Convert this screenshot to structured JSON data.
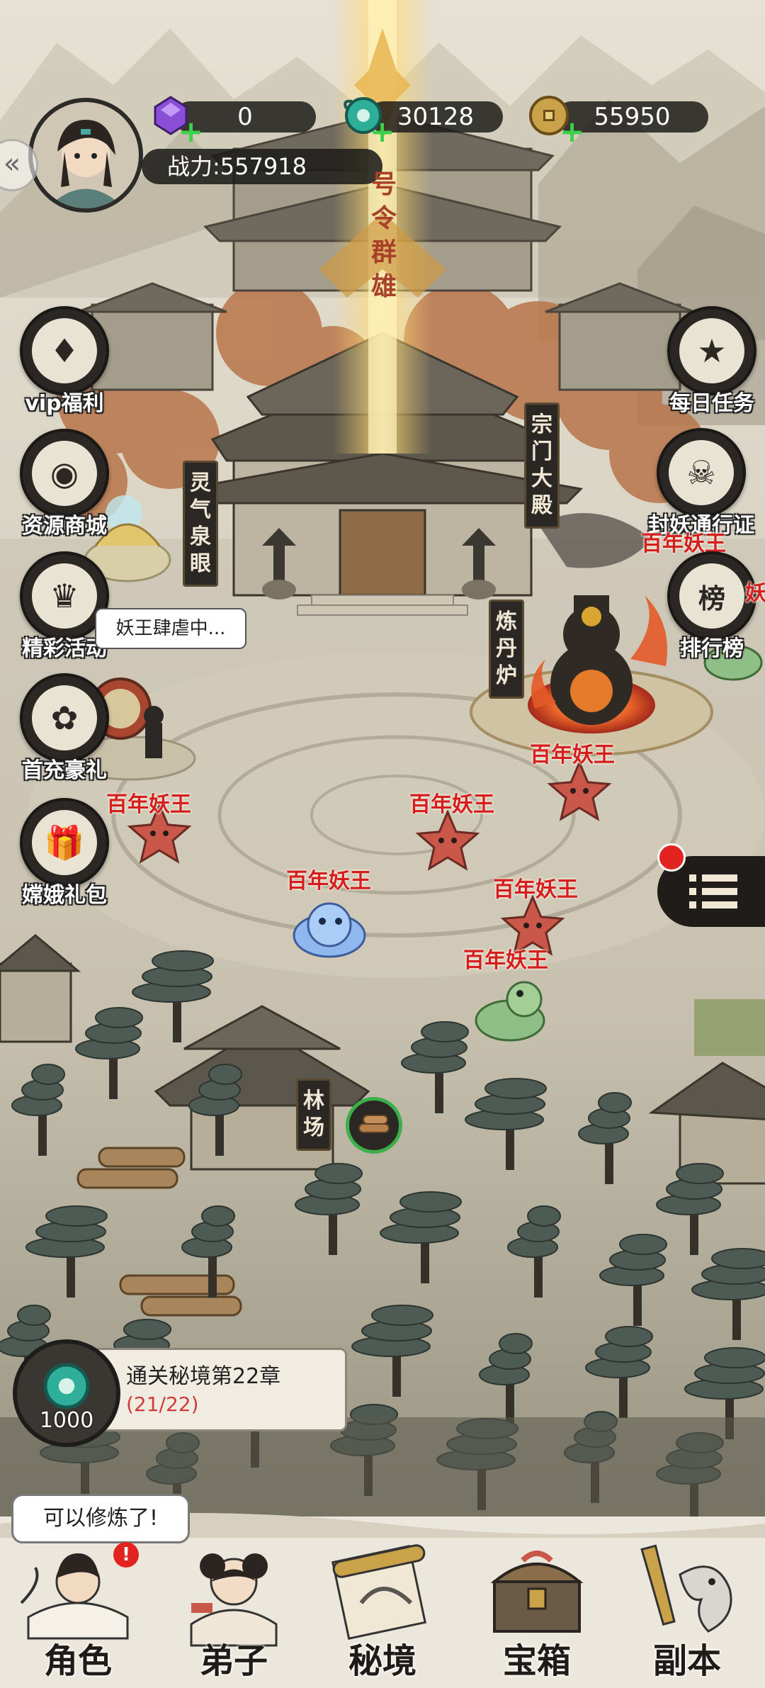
{
  "currencies": {
    "gem": {
      "value": "0",
      "icon": "purple-gem-icon"
    },
    "jade": {
      "value": "30128",
      "icon": "jade-dragon-icon"
    },
    "coin": {
      "value": "55950",
      "icon": "gold-coin-icon"
    }
  },
  "power": {
    "label": "战力:557918"
  },
  "banner_text": "号令群雄",
  "left_menu": [
    {
      "label": "vip福利",
      "icon": "vip-card-icon"
    },
    {
      "label": "资源商城",
      "icon": "shop-icon"
    },
    {
      "label": "精彩活动",
      "icon": "event-icon"
    },
    {
      "label": "首充豪礼",
      "icon": "first-charge-icon"
    },
    {
      "label": "嫦娥礼包",
      "icon": "gift-box-icon"
    }
  ],
  "right_menu": [
    {
      "label": "每日任务",
      "icon": "scroll-icon"
    },
    {
      "label": "封妖通行证",
      "icon": "demon-mask-icon"
    },
    {
      "label": "排行榜",
      "icon": "ranking-icon",
      "tag": "榜"
    }
  ],
  "building_signs": {
    "spirit_spring": "灵气泉眼",
    "sect_hall": "宗门大殿",
    "alchemy": "炼丹炉",
    "lumber": "林场"
  },
  "speech_bubble": "妖王肆虐中...",
  "demon_label": "百年妖王",
  "demon_labels_right": [
    "百年妖王",
    "妖"
  ],
  "quest": {
    "title": "通关秘境第22章",
    "progress": "(21/22)",
    "reward": "1000",
    "progress_color": "#d23a3a"
  },
  "hint_bubble": "可以修炼了!",
  "tabs": [
    {
      "label": "角色"
    },
    {
      "label": "弟子"
    },
    {
      "label": "秘境"
    },
    {
      "label": "宝箱"
    },
    {
      "label": "副本"
    }
  ],
  "colors": {
    "accent_red": "#d51f1f",
    "jade": "#2fae9a",
    "gold": "#c9a24a",
    "ink": "#2a2724"
  }
}
